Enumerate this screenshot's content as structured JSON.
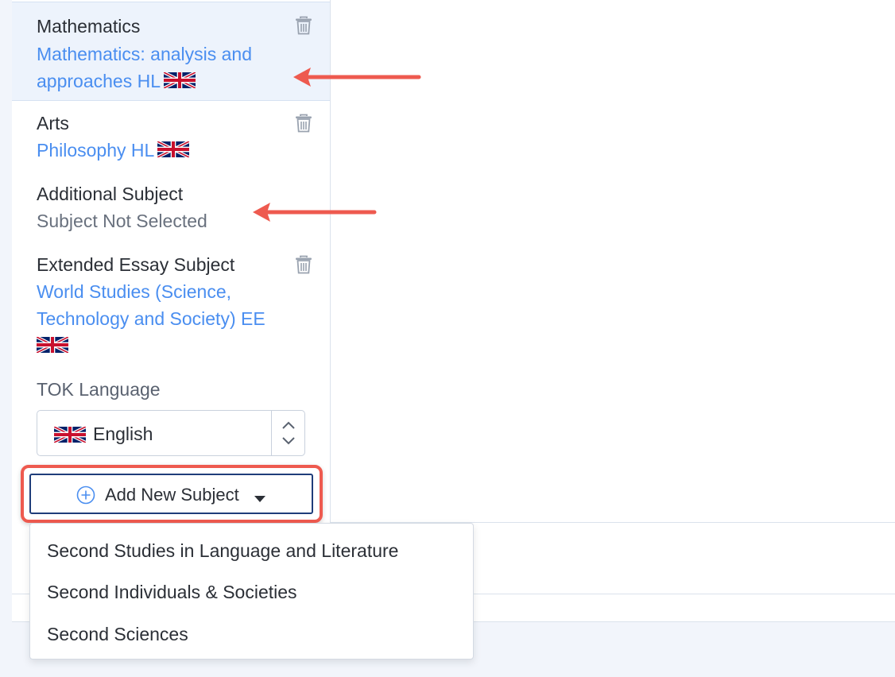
{
  "subjects": [
    {
      "group": "Mathematics",
      "selection": "Mathematics: analysis and approaches HL",
      "flag": "uk-flag-icon"
    },
    {
      "group": "Arts",
      "selection": "Philosophy HL",
      "flag": "uk-flag-icon"
    },
    {
      "group": "Additional Subject",
      "selection": "Subject Not Selected"
    },
    {
      "group": "Extended Essay Subject",
      "selection": "World Studies (Science, Technology and Society) EE",
      "flag": "uk-flag-icon"
    }
  ],
  "tok": {
    "label": "TOK Language",
    "selected": "English"
  },
  "add_button": {
    "label": "Add New Subject"
  },
  "dropdown": {
    "items": [
      "Second Studies in Language and Literature",
      "Second Individuals & Societies",
      "Second Sciences"
    ]
  },
  "colors": {
    "link": "#4a8ef0",
    "highlight": "#edf3fc",
    "annotation": "#ee5a4f",
    "button_border": "#1f3d7a"
  }
}
